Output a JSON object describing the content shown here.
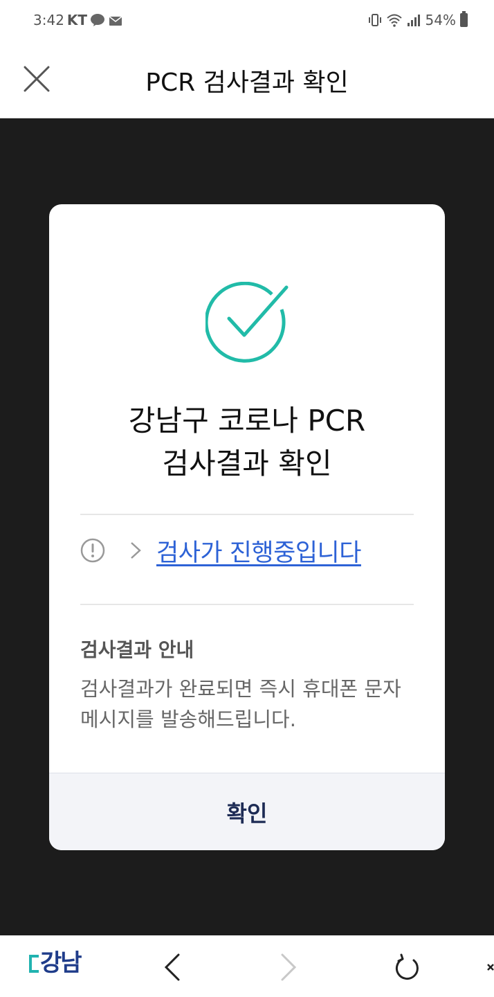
{
  "status_bar": {
    "time": "3:42",
    "carrier": "KT",
    "battery": "54%",
    "icons": [
      "kakaotalk-icon",
      "mail-icon",
      "vibrate-icon",
      "wifi-icon",
      "signal-icon",
      "battery-icon"
    ]
  },
  "header": {
    "title": "PCR 검사결과 확인",
    "close_icon": "close-icon"
  },
  "modal": {
    "title_line1": "강남구 코로나 PCR",
    "title_line2": "검사결과 확인",
    "status_link": "검사가 진행중입니다",
    "notice_title": "검사결과 안내",
    "notice_body": "검사결과가 완료되면 즉시 휴대폰 문자메시지를 발송해드립니다.",
    "confirm_label": "확인",
    "accent_color": "#21bba8",
    "link_color": "#2d62d6"
  },
  "bottom_bar": {
    "logo_text": "강남",
    "icons": [
      "back-icon",
      "forward-icon",
      "reload-icon",
      "more-icon"
    ]
  }
}
